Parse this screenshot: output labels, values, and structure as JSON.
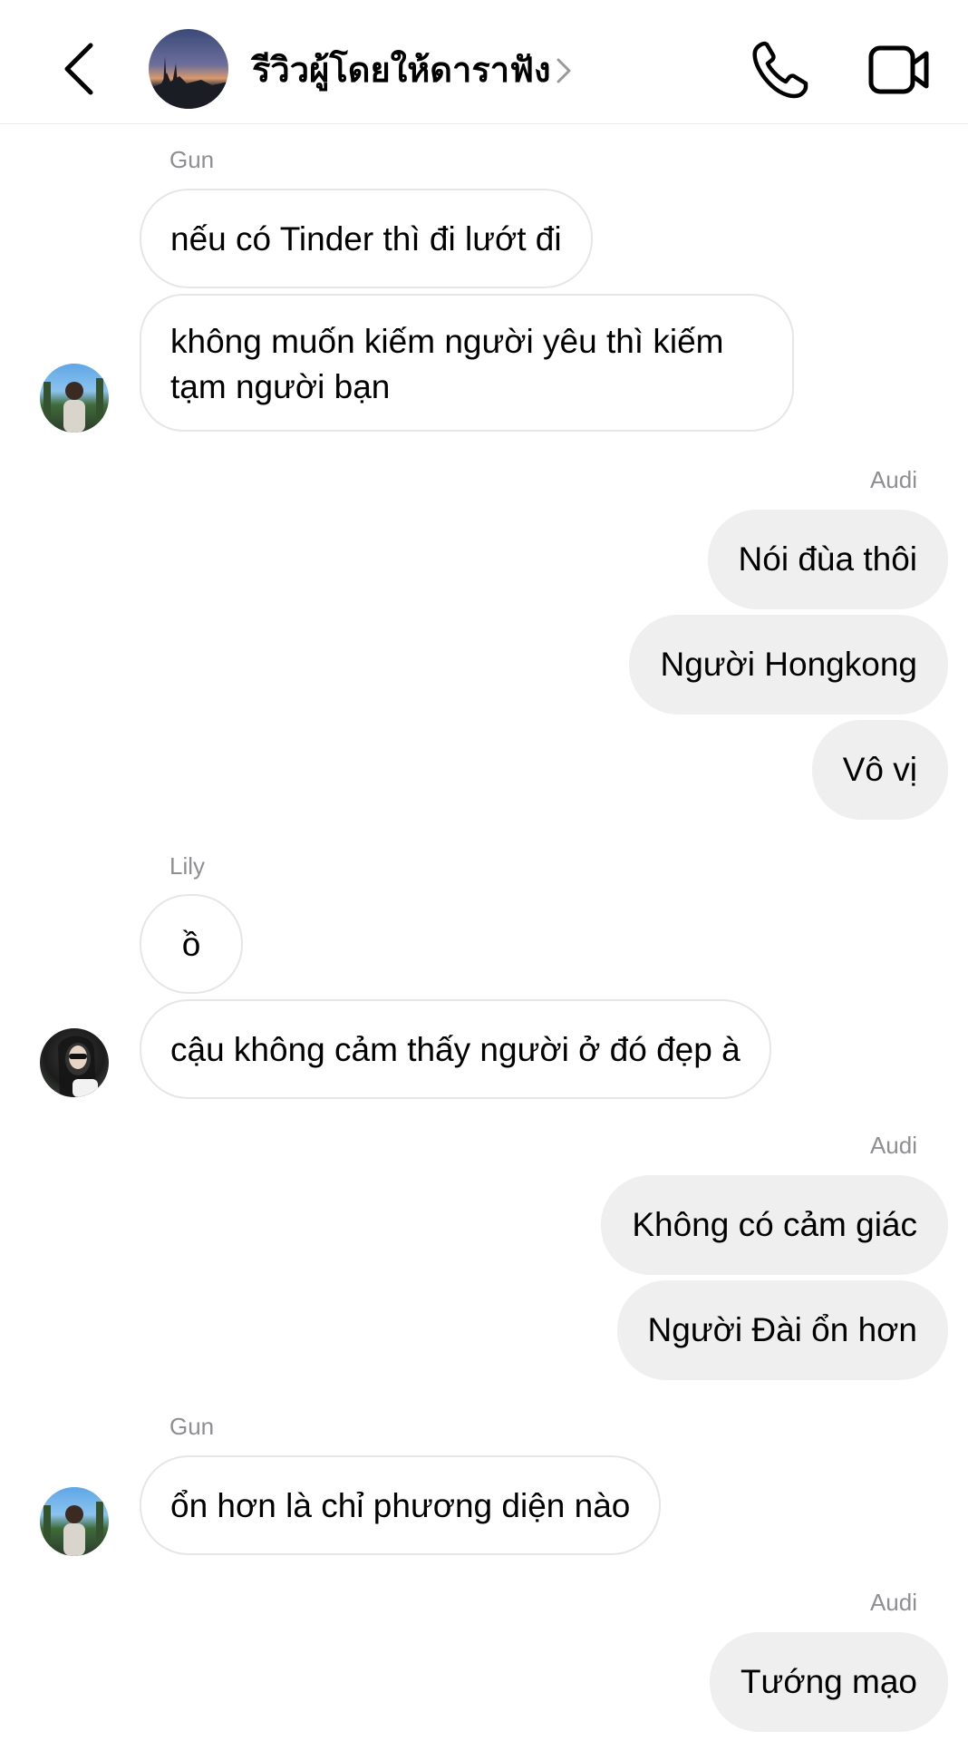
{
  "header": {
    "title": "รีวิวผู้โดยให้ดาราฟัง",
    "icons": {
      "back": "chevron-left-icon",
      "details": "chevron-right-icon",
      "call": "phone-icon",
      "video": "video-camera-icon"
    }
  },
  "thread": [
    {
      "kind": "sender",
      "side": "in",
      "text": "Gun"
    },
    {
      "kind": "message",
      "side": "in",
      "text": "nếu có Tinder thì đi lướt đi"
    },
    {
      "kind": "message",
      "side": "in",
      "text": "không muốn kiếm người yêu thì kiếm tạm người bạn",
      "avatar": "Gun"
    },
    {
      "kind": "sender",
      "side": "out",
      "text": "Audi"
    },
    {
      "kind": "message",
      "side": "out",
      "text": "Nói đùa thôi"
    },
    {
      "kind": "message",
      "side": "out",
      "text": "Người Hongkong"
    },
    {
      "kind": "message",
      "side": "out",
      "text": "Vô vị"
    },
    {
      "kind": "sender",
      "side": "in",
      "text": "Lily"
    },
    {
      "kind": "message",
      "side": "in",
      "text": "ồ"
    },
    {
      "kind": "message",
      "side": "in",
      "text": "cậu không cảm thấy người ở đó đẹp à",
      "avatar": "Lily"
    },
    {
      "kind": "sender",
      "side": "out",
      "text": "Audi"
    },
    {
      "kind": "message",
      "side": "out",
      "text": "Không có cảm giác"
    },
    {
      "kind": "message",
      "side": "out",
      "text": "Người Đài ổn hơn"
    },
    {
      "kind": "sender",
      "side": "in",
      "text": "Gun"
    },
    {
      "kind": "message",
      "side": "in",
      "text": "ổn hơn là chỉ phương diện nào",
      "avatar": "Gun"
    },
    {
      "kind": "sender",
      "side": "out",
      "text": "Audi"
    },
    {
      "kind": "message",
      "side": "out",
      "text": "Tướng mạo"
    }
  ],
  "colors": {
    "incoming_bubble_bg": "#ffffff",
    "incoming_bubble_border": "#e6e6e6",
    "outgoing_bubble_bg": "#efefef",
    "sender_label": "#8e8e93"
  }
}
